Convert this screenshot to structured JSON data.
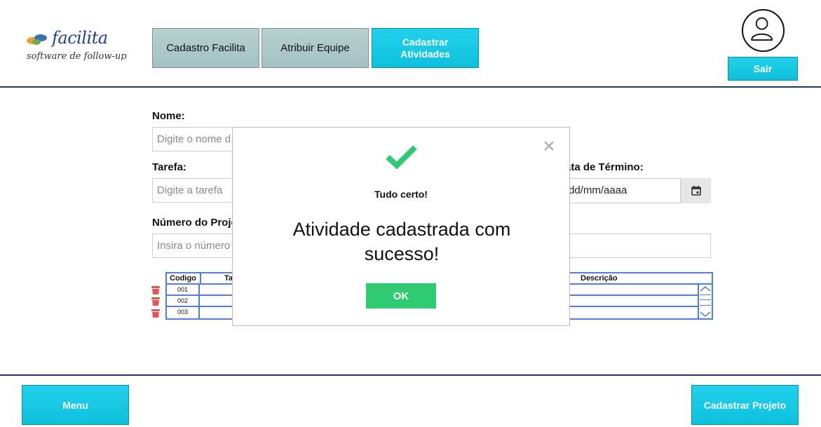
{
  "brand": {
    "name": "facilita",
    "tagline": "software de follow-up"
  },
  "tabs": [
    {
      "label": "Cadastro Facilita"
    },
    {
      "label": "Atribuir Equipe"
    },
    {
      "label": "Cadastrar Atividades"
    }
  ],
  "user": {
    "avatar_icon": "user-icon",
    "logout_label": "Sair"
  },
  "form": {
    "nome_label": "Nome:",
    "nome_placeholder": "Digite o nome d",
    "tarefa_label": "Tarefa:",
    "tarefa_placeholder": "Digite a tarefa",
    "projeto_label": "Número do Proje",
    "projeto_placeholder": "Insira o número",
    "data_termino_label": "ata de Término:",
    "data_termino_value": "dd/mm/aaaa"
  },
  "table": {
    "headers": [
      "Codigo",
      "Ta",
      "Descrição"
    ],
    "rows": [
      {
        "codigo": "001"
      },
      {
        "codigo": "002"
      },
      {
        "codigo": "003"
      }
    ]
  },
  "footer": {
    "menu_label": "Menu",
    "cadastrar_projeto_label": "Cadastrar Projeto"
  },
  "modal": {
    "title": "Tudo certo!",
    "message": "Atividade cadastrada com sucesso!",
    "ok_label": "OK",
    "close_glyph": "×"
  },
  "colors": {
    "accent": "#0fc0dd",
    "success": "#2fcb72",
    "divider": "#22346e",
    "table_border": "#4f80d0"
  }
}
